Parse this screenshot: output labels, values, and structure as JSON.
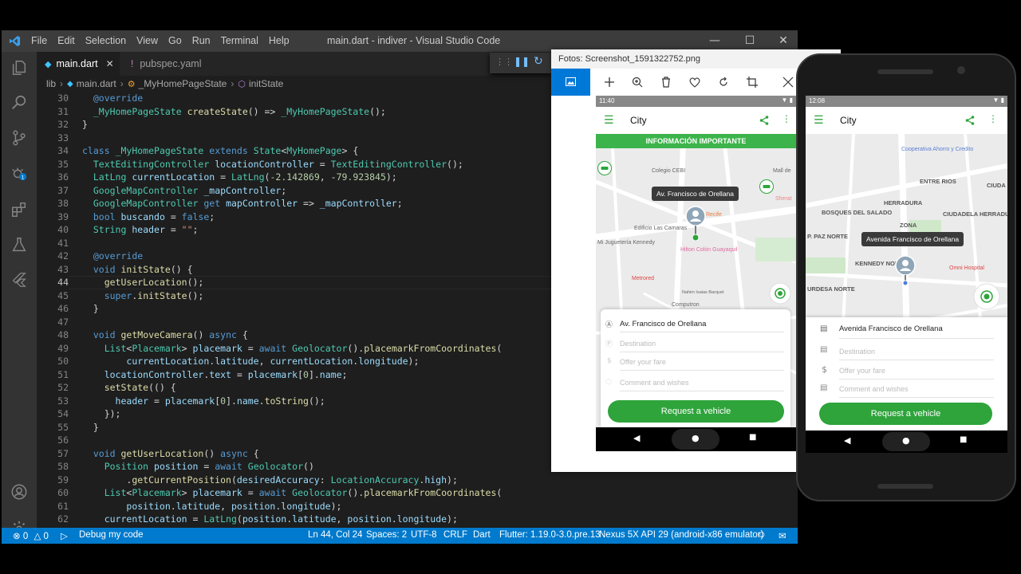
{
  "vscode": {
    "menu": [
      "File",
      "Edit",
      "Selection",
      "View",
      "Go",
      "Run",
      "Terminal",
      "Help"
    ],
    "window_title": "main.dart - indiver - Visual Studio Code",
    "tabs": [
      {
        "label": "main.dart",
        "active": true
      },
      {
        "label": "pubspec.yaml",
        "active": false
      }
    ],
    "breadcrumb": [
      "lib",
      "main.dart",
      "_MyHomePageState",
      "initState"
    ],
    "line_numbers": [
      "30",
      "31",
      "32",
      "33",
      "34",
      "35",
      "36",
      "37",
      "38",
      "39",
      "40",
      "41",
      "42",
      "43",
      "44",
      "45",
      "46",
      "47",
      "48",
      "49",
      "50",
      "51",
      "52",
      "53",
      "54",
      "55",
      "56",
      "57",
      "58",
      "59",
      "60",
      "61",
      "62"
    ],
    "code": [
      "  @override",
      "  _MyHomePageState createState() => _MyHomePageState();",
      "}",
      "",
      "class _MyHomePageState extends State<MyHomePage> {",
      "  TextEditingController locationController = TextEditingController();",
      "  LatLng currentLocation = LatLng(-2.142869, -79.923845);",
      "  GoogleMapController _mapController;",
      "  GoogleMapController get mapController => _mapController;",
      "  bool buscando = false;",
      "  String header = \"\";",
      "",
      "  @override",
      "  void initState() {",
      "    getUserLocation();",
      "    super.initState();",
      "  }",
      "",
      "  void getMoveCamera() async {",
      "    List<Placemark> placemark = await Geolocator().placemarkFromCoordinates(",
      "        currentLocation.latitude, currentLocation.longitude);",
      "    locationController.text = placemark[0].name;",
      "    setState(() {",
      "      header = placemark[0].name.toString();",
      "    });",
      "  }",
      "",
      "  void getUserLocation() async {",
      "    Position position = await Geolocator()",
      "        .getCurrentPosition(desiredAccuracy: LocationAccuracy.high);",
      "    List<Placemark> placemark = await Geolocator().placemarkFromCoordinates(",
      "        position.latitude, position.longitude);",
      "    currentLocation = LatLng(position.latitude, position.longitude);"
    ],
    "status": {
      "errors": "0",
      "warnings": "0",
      "debug": "Debug my code",
      "position": "Ln 44, Col 24",
      "spaces": "Spaces: 2",
      "encoding": "UTF-8",
      "eol": "CRLF",
      "language": "Dart",
      "flutter": "Flutter: 1.19.0-3.0.pre.13",
      "device": "Nexus 5X API 29 (android-x86 emulator)"
    },
    "colors": {
      "statusbar": "#007acc",
      "editor_bg": "#1e1e1e",
      "activitybar": "#333333"
    }
  },
  "photos": {
    "title": "Fotos: Screenshot_1591322752.png",
    "screen": {
      "time": "11:40",
      "app_title": "City",
      "banner": "INFORMACIÓN IMPORTANTE",
      "tooltip": "Av. Francisco de Orellana",
      "map_labels": [
        "Colegio CEBI",
        "Mall de",
        "Sherat",
        "Recife",
        "Edificio Las Camaras",
        "Mi Juguetería Kennedy",
        "Hilton Colón Guayaquil",
        "Metrored",
        "Computron",
        "Nahim Isaias Barquet"
      ],
      "origin": "Av. Francisco de Orellana",
      "destination_placeholder": "Destination",
      "fare_placeholder": "Offer your fare",
      "comment_placeholder": "Comment and wishes",
      "button": "Request a vehicle"
    }
  },
  "emulator": {
    "screen": {
      "time": "12:08",
      "app_title": "City",
      "tooltip": "Avenida Francisco de Orellana",
      "map_labels": [
        "Cooperativa Ahorro y Credito",
        "ENTRE RIOS",
        "CIUDA LA GA",
        "HERRADURA",
        "ZONA",
        "BOSQUES DEL SALADO",
        "CIUDADELA HERRADURA NORTE",
        "P. PAZ NORTE",
        "KENNEDY NORTE",
        "Omni Hospital",
        "URDESA NORTE"
      ],
      "origin": "Avenida Francisco de Orellana",
      "destination_placeholder": "Destination",
      "fare_placeholder": "Offer your fare",
      "comment_placeholder": "Comment and wishes",
      "button": "Request a vehicle"
    }
  },
  "app_colors": {
    "primary_green": "#2ea43b",
    "banner_green": "#3cb44b"
  }
}
